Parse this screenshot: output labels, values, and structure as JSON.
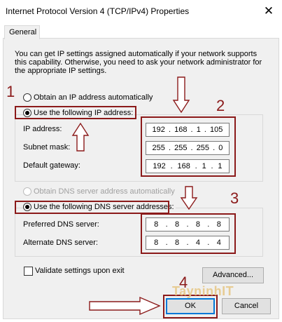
{
  "window": {
    "title": "Internet Protocol Version 4 (TCP/IPv4) Properties",
    "close_glyph": "✕"
  },
  "tabs": [
    {
      "label": "General"
    }
  ],
  "description": "You can get IP settings assigned automatically if your network supports this capability. Otherwise, you need to ask your network administrator for the appropriate IP settings.",
  "ip_mode": {
    "auto_label": "Obtain an IP address automatically",
    "manual_label": "Use the following IP address:",
    "selected": "manual"
  },
  "ip_fields": {
    "ip_address": {
      "label": "IP address:",
      "octets": [
        "192",
        "168",
        "1",
        "105"
      ]
    },
    "subnet_mask": {
      "label": "Subnet mask:",
      "octets": [
        "255",
        "255",
        "255",
        "0"
      ]
    },
    "default_gateway": {
      "label": "Default gateway:",
      "octets": [
        "192",
        "168",
        "1",
        "1"
      ]
    }
  },
  "dns_mode": {
    "auto_label": "Obtain DNS server address automatically",
    "manual_label": "Use the following DNS server addresses:",
    "selected": "manual"
  },
  "dns_fields": {
    "preferred": {
      "label": "Preferred DNS server:",
      "octets": [
        "8",
        "8",
        "8",
        "8"
      ]
    },
    "alternate": {
      "label": "Alternate DNS server:",
      "octets": [
        "8",
        "8",
        "4",
        "4"
      ]
    }
  },
  "validate_checkbox": {
    "label": "Validate settings upon exit",
    "checked": false
  },
  "buttons": {
    "advanced": "Advanced...",
    "ok": "OK",
    "cancel": "Cancel"
  },
  "annotations": {
    "step_numbers": [
      "1",
      "2",
      "3",
      "4"
    ],
    "color": "#8b1a1a",
    "watermark": "TayninhIT"
  }
}
